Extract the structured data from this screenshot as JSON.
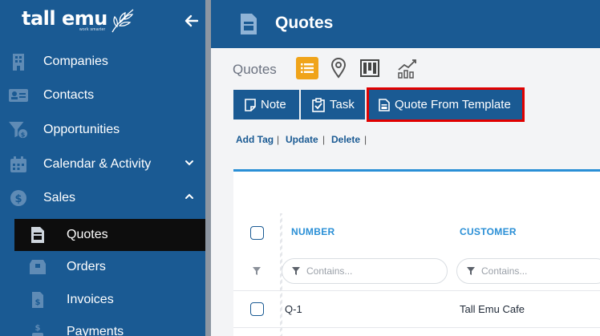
{
  "app": {
    "logo_text": "tall emu",
    "logo_tagline": "work smarter"
  },
  "sidebar": {
    "items": [
      {
        "label": "Companies",
        "icon": "building-icon"
      },
      {
        "label": "Contacts",
        "icon": "contact-card-icon"
      },
      {
        "label": "Opportunities",
        "icon": "funnel-dollar-icon"
      },
      {
        "label": "Calendar & Activity",
        "icon": "calendar-icon",
        "chevron": "down"
      },
      {
        "label": "Sales",
        "icon": "dollar-circle-icon",
        "chevron": "up"
      }
    ],
    "sub_items": [
      {
        "label": "Quotes",
        "icon": "quote-doc-icon",
        "active": true
      },
      {
        "label": "Orders",
        "icon": "box-icon"
      },
      {
        "label": "Invoices",
        "icon": "invoice-icon"
      },
      {
        "label": "Payments",
        "icon": "payment-icon"
      }
    ]
  },
  "header": {
    "title": "Quotes"
  },
  "toolbar": {
    "view_label": "Quotes",
    "views": [
      "list",
      "map",
      "kanban",
      "chart"
    ],
    "note_label": "Note",
    "task_label": "Task",
    "template_label": "Quote From Template"
  },
  "links": {
    "add_tag": "Add Tag",
    "update": "Update",
    "delete": "Delete",
    "separator": "|"
  },
  "grid": {
    "columns": [
      "NUMBER",
      "CUSTOMER"
    ],
    "filter_placeholder": "Contains...",
    "rows": [
      {
        "number": "Q-1",
        "customer": "Tall Emu Cafe"
      }
    ]
  },
  "colors": {
    "sidebar_bg": "#1a5a93",
    "accent_orange": "#f0a41a",
    "accent_blue": "#2a8fd6",
    "highlight_red": "#e00000"
  }
}
